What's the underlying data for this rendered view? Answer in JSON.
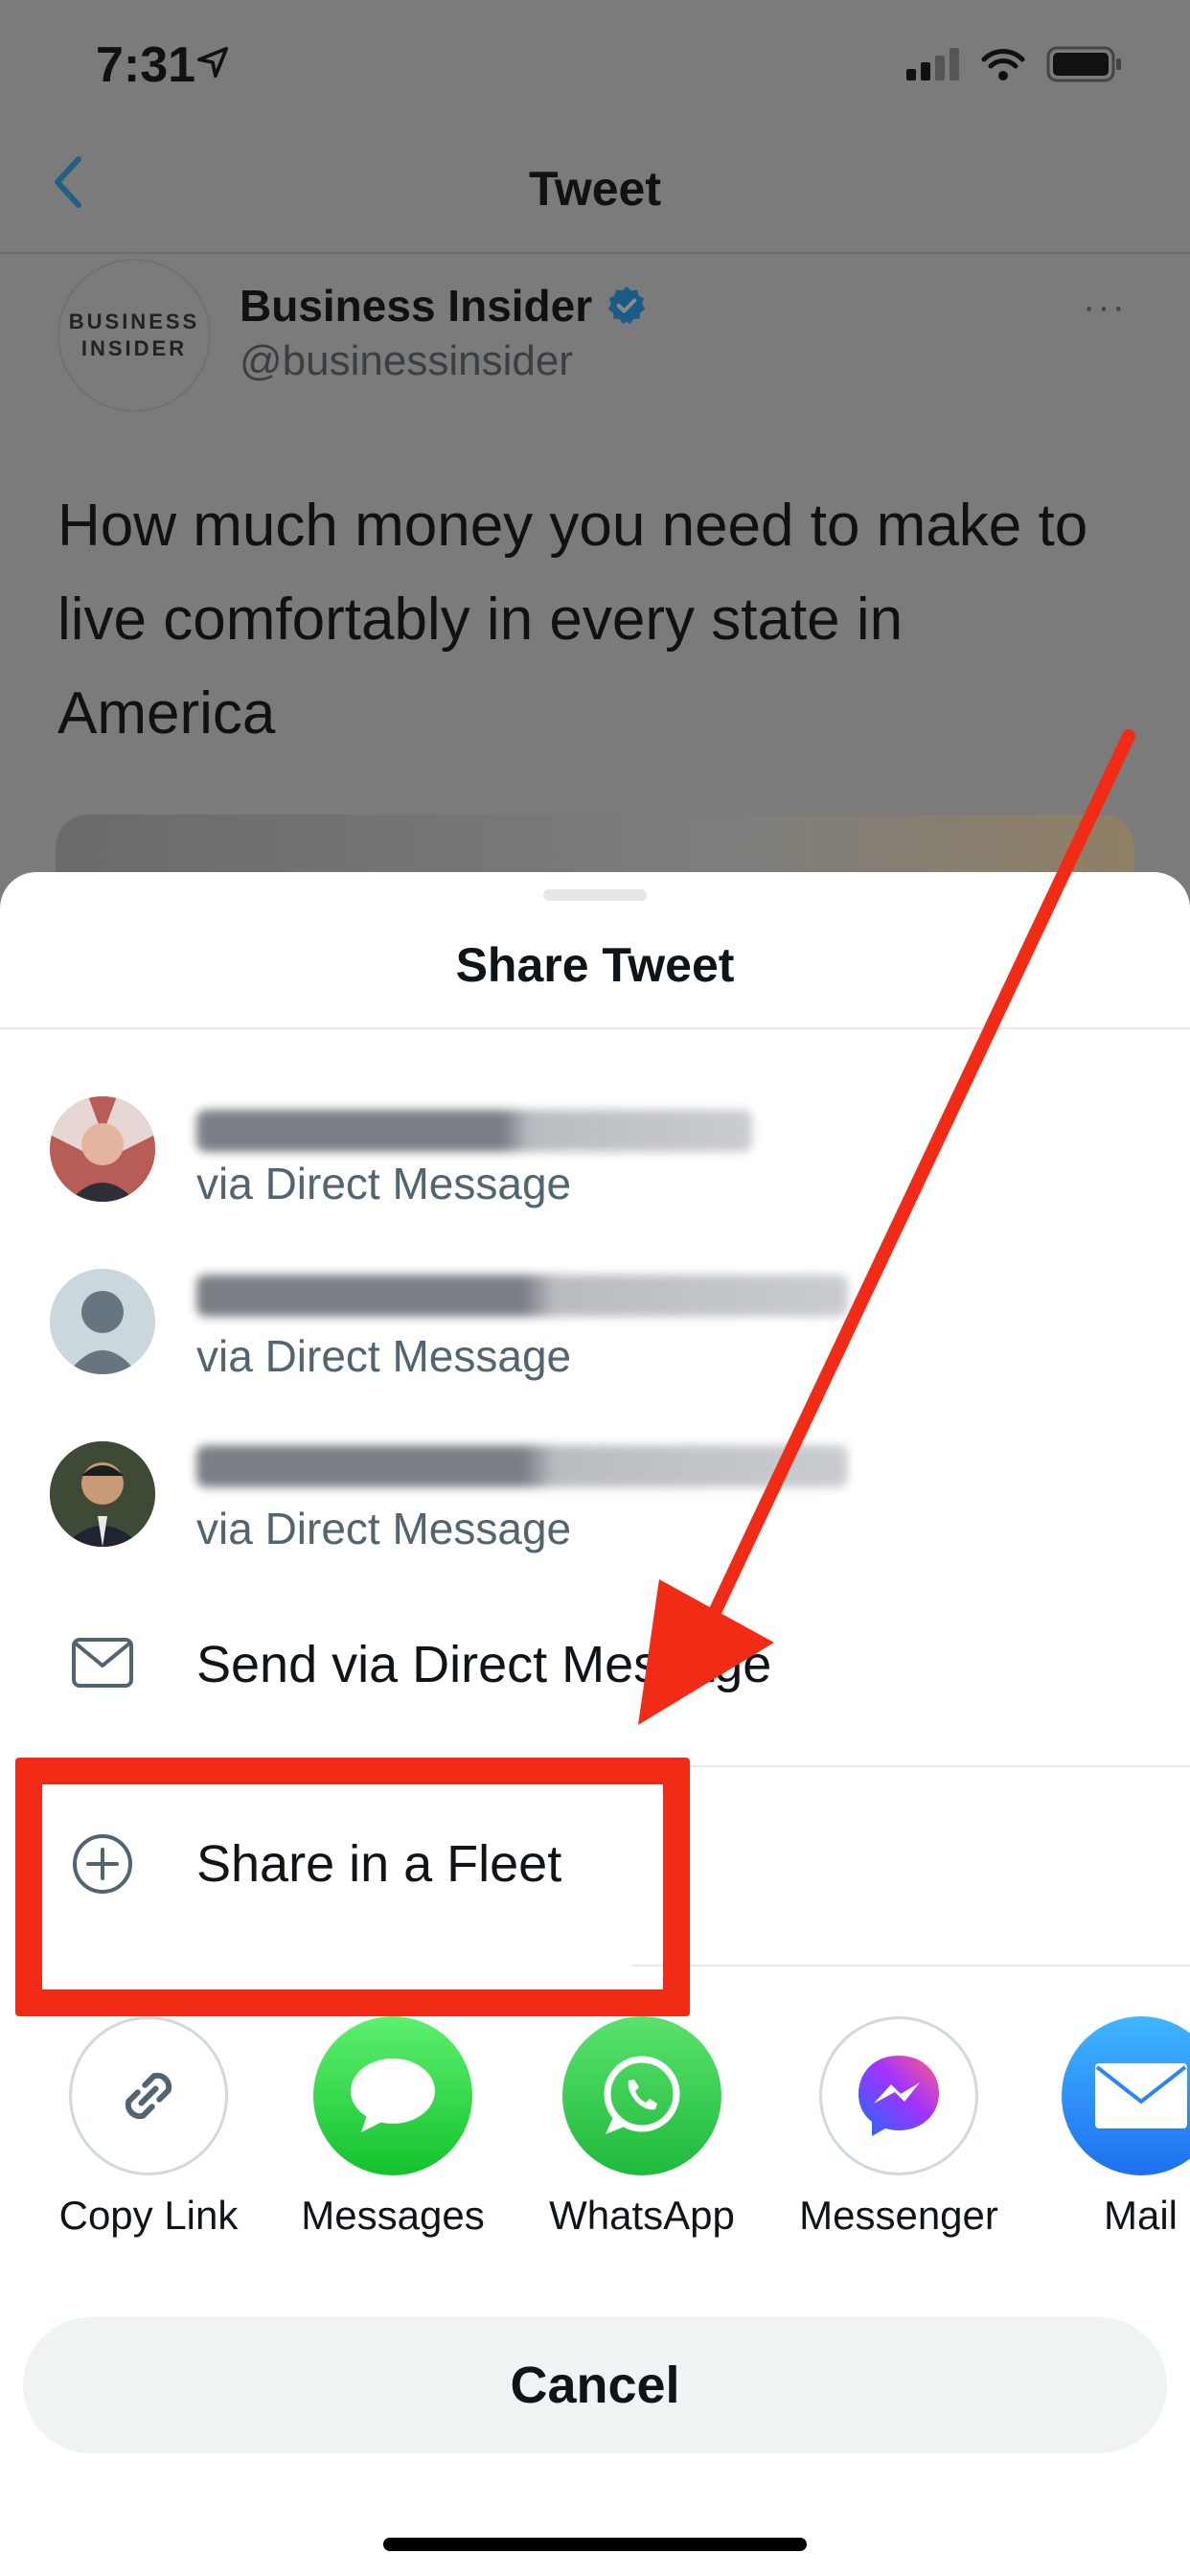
{
  "status_bar": {
    "time": "7:31"
  },
  "nav": {
    "title": "Tweet"
  },
  "tweet": {
    "avatar_text_1": "BUSINESS",
    "avatar_text_2": "INSIDER",
    "author_name": "Business Insider",
    "author_handle": "@businessinsider",
    "more": "···",
    "text": "How much money you need to make to live comfortably in every state in America"
  },
  "sheet": {
    "title": "Share Tweet",
    "recent_dms": [
      {
        "subtitle": "via Direct Message"
      },
      {
        "subtitle": "via Direct Message"
      },
      {
        "subtitle": "via Direct Message"
      }
    ],
    "send_dm_label": "Send via Direct Message",
    "fleet_label": "Share in a Fleet",
    "share_targets": [
      {
        "label": "Copy Link",
        "icon": "link-icon"
      },
      {
        "label": "Messages",
        "icon": "messages-icon"
      },
      {
        "label": "WhatsApp",
        "icon": "whatsapp-icon"
      },
      {
        "label": "Messenger",
        "icon": "messenger-icon"
      },
      {
        "label": "Mail",
        "icon": "mail-icon"
      }
    ],
    "cancel_label": "Cancel"
  },
  "colors": {
    "overlay": "#7b7b7b",
    "accent_blue": "#1d9bf0",
    "annotation_red": "#f22b16",
    "secondary_text": "#536471"
  }
}
